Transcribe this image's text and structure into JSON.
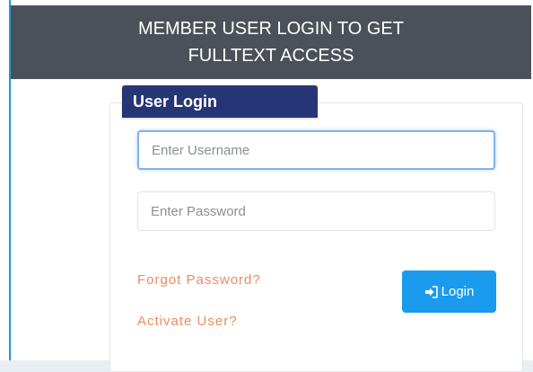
{
  "header": {
    "line1": "MEMBER USER LOGIN TO GET",
    "line2": "FULLTEXT ACCESS"
  },
  "login_panel": {
    "title": "User Login",
    "username_placeholder": "Enter Username",
    "password_placeholder": "Enter Password",
    "forgot_link": "Forgot Password?",
    "activate_link": "Activate User?",
    "login_button": "Login",
    "login_icon": "sign-in-icon"
  },
  "colors": {
    "header_bg": "#4c5159",
    "tab_bg": "#263575",
    "link": "#ee8a5c",
    "button": "#1a9bee",
    "accent_rule": "#1f9ad6"
  }
}
